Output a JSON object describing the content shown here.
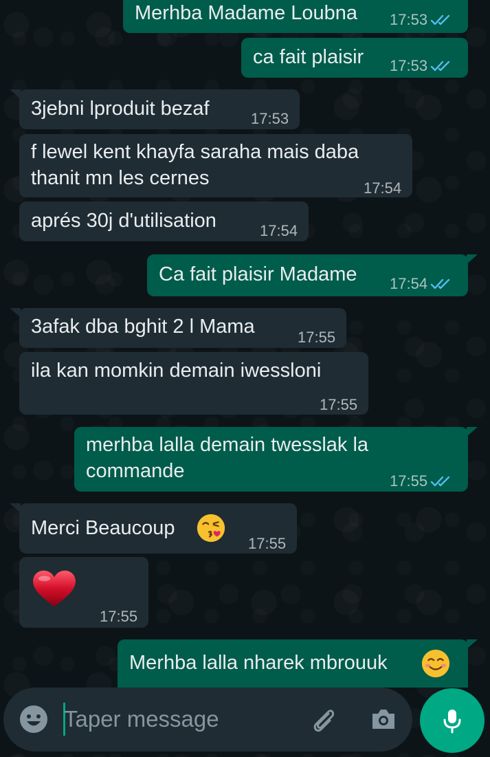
{
  "messages": [
    {
      "dir": "out",
      "text": "Merhba Madame Loubna",
      "time": "17:53",
      "status": "read"
    },
    {
      "dir": "out",
      "text": "ca fait plaisir",
      "time": "17:53",
      "status": "read"
    },
    {
      "dir": "in",
      "text": "3jebni lproduit bezaf",
      "time": "17:53"
    },
    {
      "dir": "in",
      "line1": "f lewel kent khayfa saraha mais daba",
      "line2": "thanit mn les cernes",
      "time": "17:54"
    },
    {
      "dir": "in",
      "text": "aprés 30j d'utilisation",
      "time": "17:54"
    },
    {
      "dir": "out",
      "text": "Ca fait plaisir Madame",
      "time": "17:54",
      "status": "read"
    },
    {
      "dir": "in",
      "text": "3afak dba bghit 2 l Mama",
      "time": "17:55"
    },
    {
      "dir": "in",
      "text": "ila kan momkin demain iwessloni",
      "time": "17:55"
    },
    {
      "dir": "out",
      "line1": "merhba lalla demain twesslak la",
      "line2": "commande",
      "time": "17:55",
      "status": "read"
    },
    {
      "dir": "in",
      "text": "Merci Beaucoup",
      "emoji": "face-blowing-kiss-icon",
      "time": "17:55"
    },
    {
      "dir": "in",
      "emoji": "red-heart-icon",
      "time": "17:55"
    },
    {
      "dir": "out",
      "text": "Merhba lalla nharek mbrouuk",
      "emoji": "smiling-face-icon"
    }
  ],
  "composer": {
    "placeholder": "Taper message",
    "icons": [
      "emoji-icon",
      "attach-icon",
      "camera-icon",
      "mic-icon"
    ]
  },
  "colors": {
    "outgoing_bubble": "#005c4b",
    "incoming_bubble": "#1f2c34",
    "read_ticks": "#53bdeb",
    "mic_button": "#00a884"
  }
}
